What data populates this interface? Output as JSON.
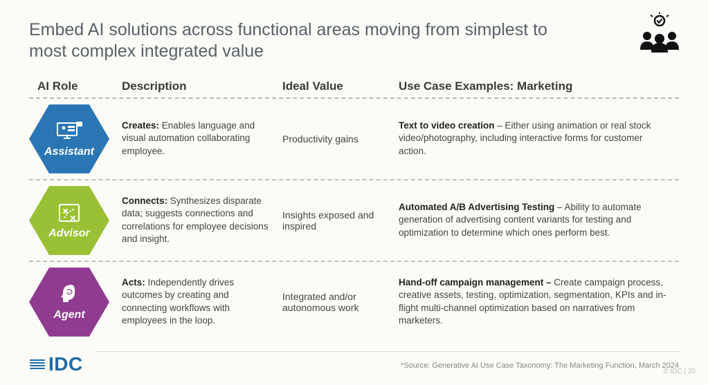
{
  "title": "Embed AI solutions across functional areas moving from simplest to most complex integrated value",
  "columns": {
    "role": "AI Role",
    "description": "Description",
    "ideal": "Ideal Value",
    "usecase": "Use Case Examples: Marketing"
  },
  "rows": [
    {
      "role": "Assistant",
      "color": "#2a76b5",
      "desc_bold": "Creates:",
      "desc_rest": " Enables language and visual automation collaborating employee.",
      "ideal": "Productivity gains",
      "use_bold": "Text to video creation",
      "use_rest": " – Either using animation or real stock video/photography, including interactive forms for customer action."
    },
    {
      "role": "Advisor",
      "color": "#9ac136",
      "desc_bold": "Connects:",
      "desc_rest": " Synthesizes disparate data; suggests connections and correlations for employee decisions and insight.",
      "ideal": "Insights exposed and inspired",
      "use_bold": "Automated A/B Advertising Testing",
      "use_rest": " – Ability to automate generation of advertising content variants for testing and optimization to determine which ones perform best."
    },
    {
      "role": "Agent",
      "color": "#8f3b90",
      "desc_bold": "Acts:",
      "desc_rest": " Independently drives outcomes by creating and connecting workflows with employees in the loop.",
      "ideal": "Integrated and/or autonomous work",
      "use_bold": "Hand-off campaign management –",
      "use_rest": " Create campaign process, creative assets, testing, optimization, segmentation, KPIs and in-flight multi-channel optimization based on narratives from marketers."
    }
  ],
  "source": "*Source: Generative AI Use Case Taxonomy: The Marketing Function, March 2024",
  "logo": "IDC",
  "pagenum": "© IDC  |   20"
}
